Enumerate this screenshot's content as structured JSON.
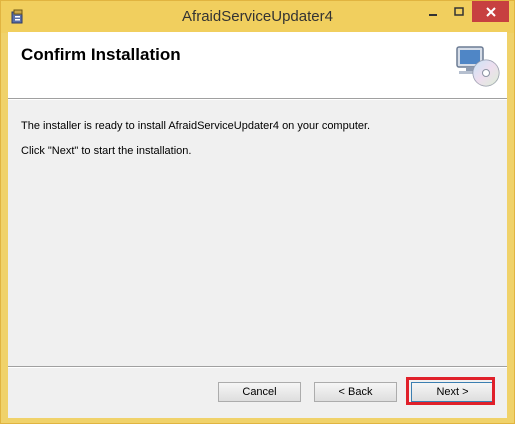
{
  "window": {
    "title": "AfraidServiceUpdater4",
    "colors": {
      "titlebar": "#f1cf5e",
      "close": "#c74040",
      "highlight": "#e0202a"
    }
  },
  "header": {
    "title": "Confirm Installation",
    "icon": "computer-cd-icon"
  },
  "body": {
    "line1": "The installer is ready to install AfraidServiceUpdater4 on your computer.",
    "line2": "Click \"Next\" to start the installation."
  },
  "buttons": {
    "cancel": "Cancel",
    "back": "< Back",
    "next": "Next >"
  }
}
